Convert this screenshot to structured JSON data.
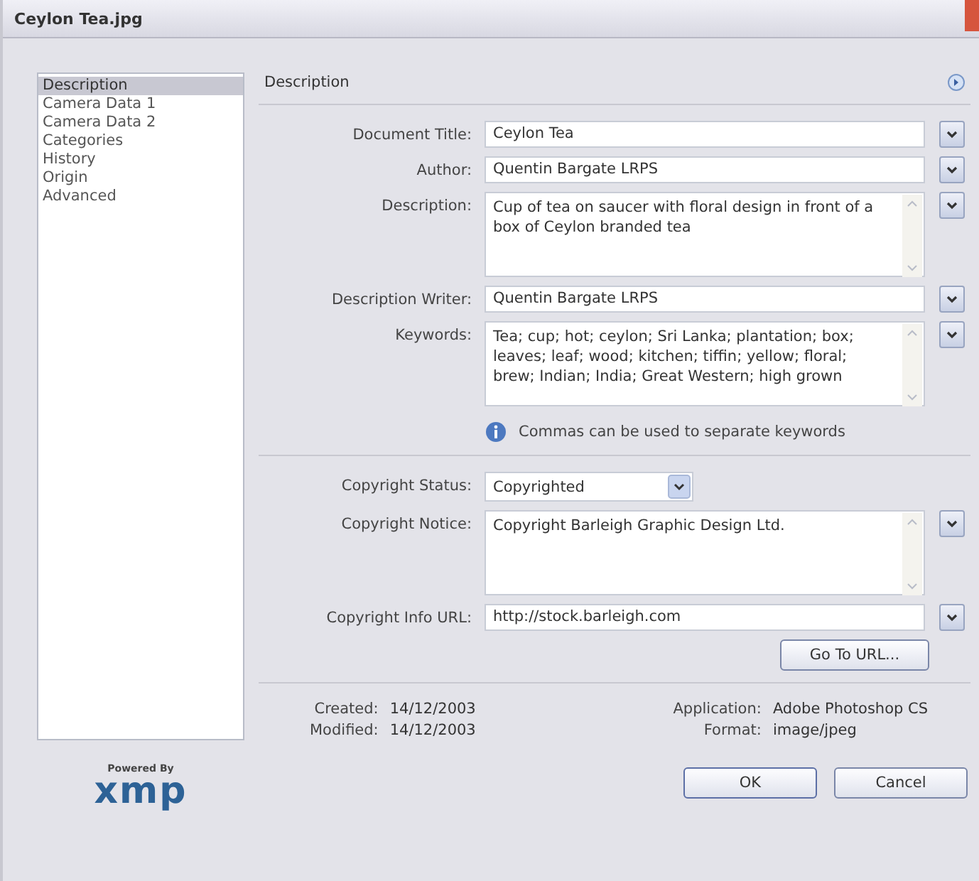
{
  "window": {
    "title": "Ceylon Tea.jpg"
  },
  "sidebar": {
    "items": [
      {
        "label": "Description",
        "selected": true
      },
      {
        "label": "Camera Data 1",
        "selected": false
      },
      {
        "label": "Camera Data 2",
        "selected": false
      },
      {
        "label": "Categories",
        "selected": false
      },
      {
        "label": "History",
        "selected": false
      },
      {
        "label": "Origin",
        "selected": false
      },
      {
        "label": "Advanced",
        "selected": false
      }
    ]
  },
  "logo": {
    "caption": "Powered By",
    "mark": "xmp"
  },
  "panel": {
    "title": "Description"
  },
  "sections": [
    {
      "fields": [
        {
          "kind": "text",
          "label": "Document Title:",
          "value": "Ceylon Tea",
          "menu": true
        },
        {
          "kind": "text",
          "label": "Author:",
          "value": "Quentin Bargate LRPS",
          "menu": true
        },
        {
          "kind": "textarea",
          "label": "Description:",
          "value": "Cup of tea on saucer with floral design in front of a box of Ceylon branded tea",
          "menu": true
        },
        {
          "kind": "text",
          "label": "Description Writer:",
          "value": "Quentin Bargate LRPS",
          "menu": true
        },
        {
          "kind": "textarea",
          "label": "Keywords:",
          "value": "Tea; cup; hot; ceylon; Sri Lanka; plantation; box; leaves; leaf; wood; kitchen; tiffin; yellow; floral; brew; Indian; India; Great Western; high grown",
          "menu": true
        }
      ],
      "note": "Commas can be used to separate keywords"
    },
    {
      "fields": [
        {
          "kind": "select",
          "label": "Copyright Status:",
          "value": "Copyrighted",
          "menu": false
        },
        {
          "kind": "textarea",
          "label": "Copyright Notice:",
          "value": "Copyright Barleigh Graphic Design Ltd.",
          "menu": true
        },
        {
          "kind": "text",
          "label": "Copyright Info URL:",
          "value": "http://stock.barleigh.com",
          "menu": true
        }
      ],
      "button": "Go To URL..."
    }
  ],
  "info": {
    "left": [
      {
        "label": "Created:",
        "value": "14/12/2003"
      },
      {
        "label": "Modified:",
        "value": "14/12/2003"
      }
    ],
    "right": [
      {
        "label": "Application:",
        "value": "Adobe Photoshop CS"
      },
      {
        "label": "Format:",
        "value": "image/jpeg"
      }
    ]
  },
  "buttons": [
    "OK",
    "Cancel"
  ]
}
